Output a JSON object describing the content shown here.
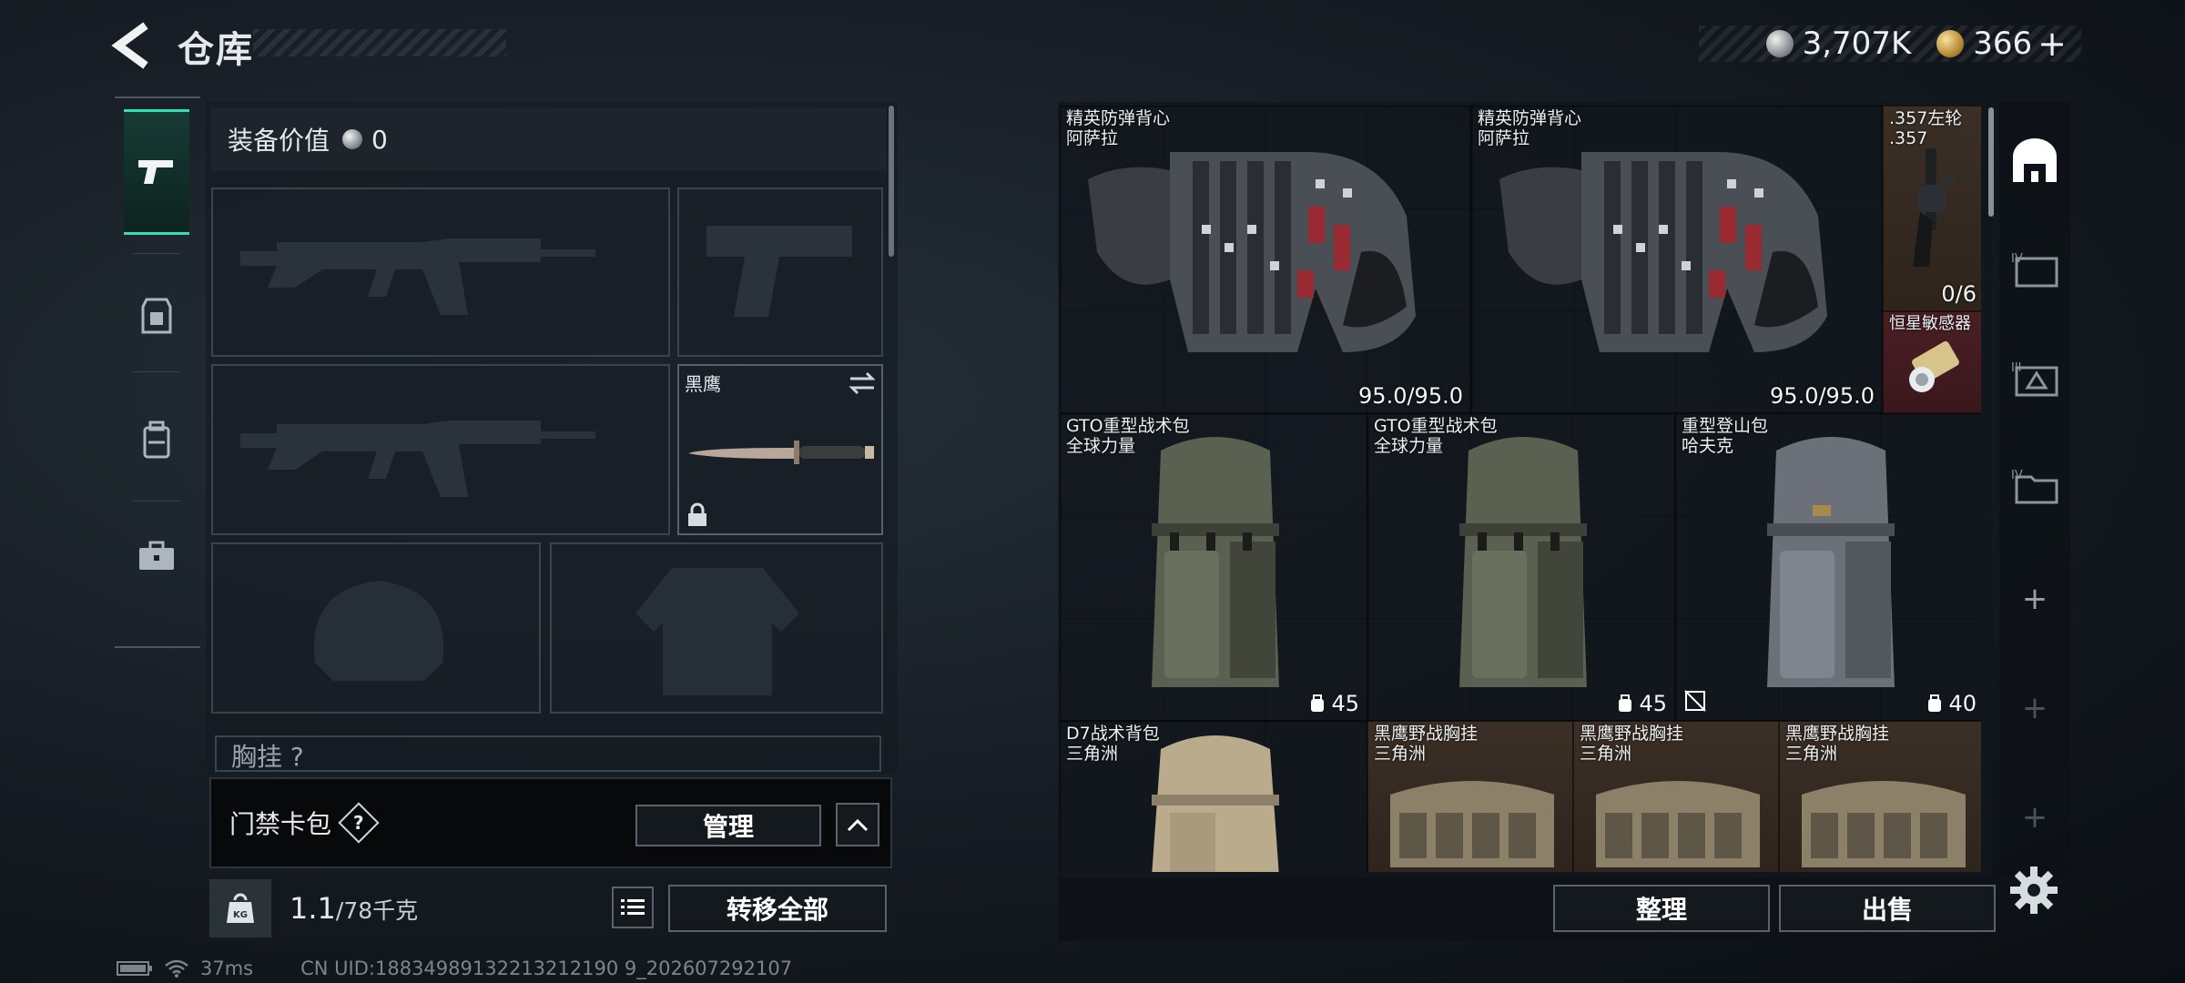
{
  "header": {
    "title": "仓库",
    "currency_silver": "3,707K",
    "currency_gold": "366",
    "plus": "+"
  },
  "loadout": {
    "equip_value_label": "装备价值",
    "equip_value": "0",
    "knife_name": "黑鹰",
    "chest_label": "胸挂 ?",
    "keycard_label": "门禁卡包",
    "keycard_help": "?",
    "manage_label": "管理",
    "weight_current": "1.1",
    "weight_max": "/78千克",
    "transfer_all_label": "转移全部",
    "kg_label": "KG"
  },
  "status": {
    "ping": "37ms",
    "uid": "CN UID:18834989132213212190 9_202607292107"
  },
  "stash": {
    "items": [
      {
        "name1": "精英防弹背心",
        "name2": "阿萨拉",
        "value": "95.0/95.0"
      },
      {
        "name1": "精英防弹背心",
        "name2": "阿萨拉",
        "value": "95.0/95.0"
      },
      {
        "name1": ".357左轮",
        "name2": ".357",
        "value": "0/6"
      },
      {
        "name1": "恒星敏感器",
        "name2": "",
        "value": ""
      },
      {
        "name1": "GTO重型战术包",
        "name2": "全球力量",
        "value": "45"
      },
      {
        "name1": "GTO重型战术包",
        "name2": "全球力量",
        "value": "45"
      },
      {
        "name1": "重型登山包",
        "name2": "哈夫克",
        "value": "40"
      },
      {
        "name1": "D7战术背包",
        "name2": "三角洲",
        "value": ""
      },
      {
        "name1": "黑鹰野战胸挂",
        "name2": "三角洲",
        "value": ""
      },
      {
        "name1": "黑鹰野战胸挂",
        "name2": "三角洲",
        "value": ""
      },
      {
        "name1": "黑鹰野战胸挂",
        "name2": "三角洲",
        "value": ""
      }
    ],
    "sort_label": "整理",
    "sell_label": "出售"
  },
  "rail": {
    "plus": "+"
  },
  "colors": {
    "accent": "#2fe0b0",
    "item_brown": "#3b2f26",
    "item_red": "#4a1f24"
  },
  "icons": [
    "back-arrow-icon",
    "pistol-icon",
    "armor-icon",
    "backpack-icon",
    "toolbox-icon",
    "lock-icon",
    "swap-icon",
    "list-icon",
    "settings-gear-icon",
    "wifi-icon",
    "battery-icon"
  ]
}
